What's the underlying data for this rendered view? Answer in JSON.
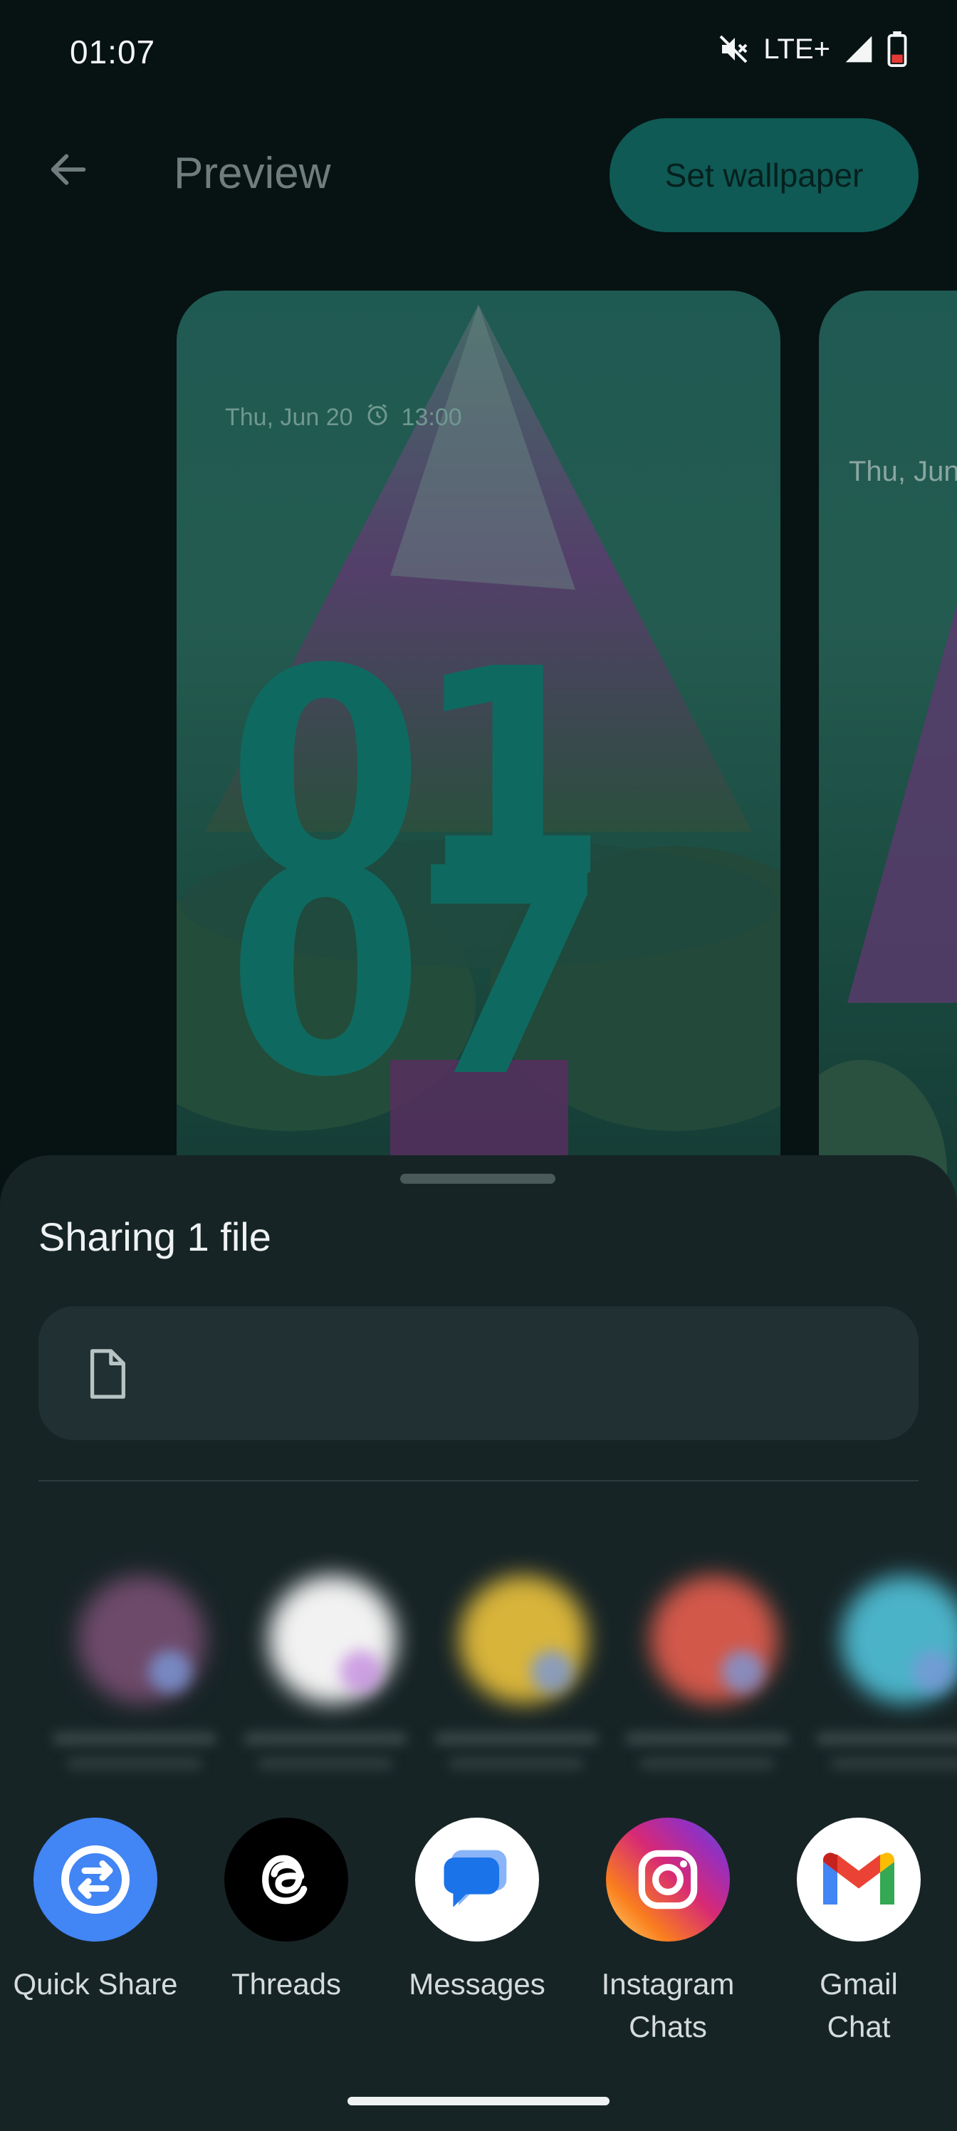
{
  "status_bar": {
    "time": "01:07",
    "network": "LTE+",
    "icons": [
      "mute-icon",
      "signal-icon",
      "battery-low-icon"
    ]
  },
  "app_bar": {
    "title": "Preview",
    "back_icon": "arrow-left-icon",
    "set_wallpaper_label": "Set wallpaper"
  },
  "preview": {
    "date": "Thu, Jun 20",
    "alarm_time": "13:00",
    "clock_hour": "01",
    "clock_minute": "07",
    "second_card_date": "Thu, Jun"
  },
  "share_sheet": {
    "title": "Sharing 1 file",
    "file_icon": "file-icon",
    "apps": [
      {
        "name": "Quick Share",
        "line1": "Quick Share",
        "line2": "",
        "icon": "quick-share-icon",
        "color": "#4285f4"
      },
      {
        "name": "Threads",
        "line1": "Threads",
        "line2": "",
        "icon": "threads-icon",
        "color": "#000000"
      },
      {
        "name": "Messages",
        "line1": "Messages",
        "line2": "",
        "icon": "messages-icon",
        "color": "#ffffff"
      },
      {
        "name": "Instagram Chats",
        "line1": "Instagram",
        "line2": "Chats",
        "icon": "instagram-icon",
        "color": "#e1306c"
      },
      {
        "name": "Gmail Chat",
        "line1": "Gmail",
        "line2": "Chat",
        "icon": "gmail-icon",
        "color": "#ffffff"
      }
    ]
  },
  "colors": {
    "accent": "#0f5a55",
    "sheet_background": "#172426",
    "clock": "#0e6a60"
  }
}
